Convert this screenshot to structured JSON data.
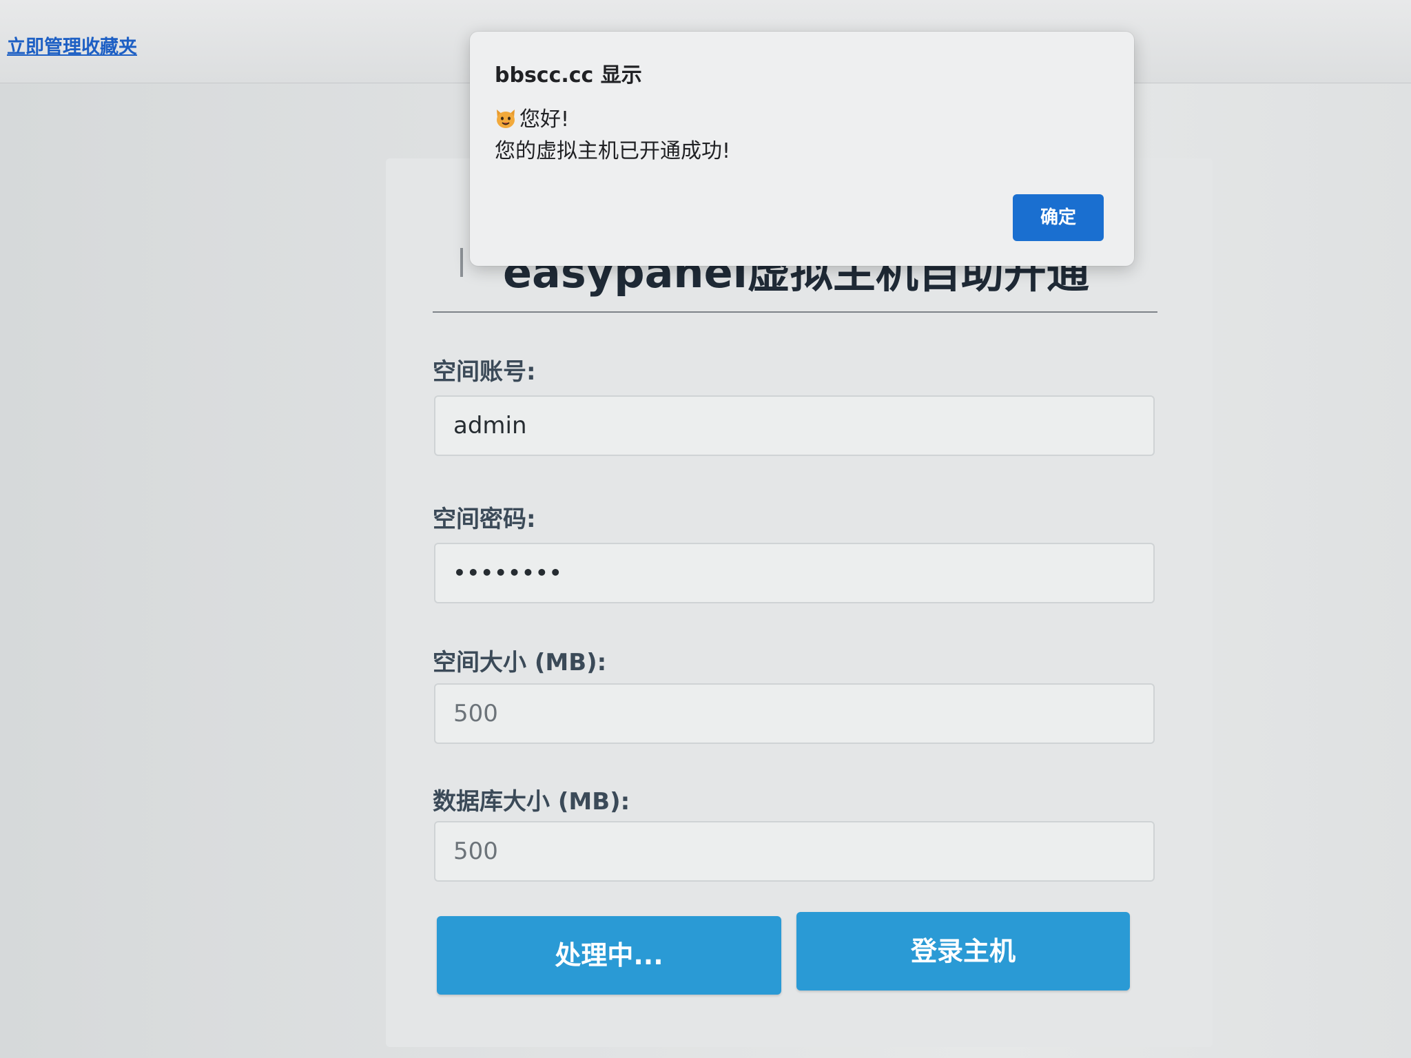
{
  "bookmarks": {
    "manage_label": "立即管理收藏夹"
  },
  "form": {
    "title": "easypanel虚拟主机自助开通",
    "fields": [
      {
        "label": "空间账号:",
        "value": "admin"
      },
      {
        "label": "空间密码:",
        "value": "••••••••"
      },
      {
        "label": "空间大小 (MB):",
        "value": "500"
      },
      {
        "label": "数据库大小 (MB):",
        "value": "500"
      }
    ],
    "buttons": {
      "submit_label": "处理中...",
      "login_label": "登录主机"
    }
  },
  "dialog": {
    "title": "bbscc.cc 显示",
    "greeting": "您好!",
    "message": "您的虚拟主机已开通成功!",
    "icon": "cat-face-icon",
    "ok_label": "确定"
  },
  "colors": {
    "primary_button": "#2a9ad5",
    "dialog_button": "#1a6fd0",
    "link": "#1d5fc4"
  }
}
